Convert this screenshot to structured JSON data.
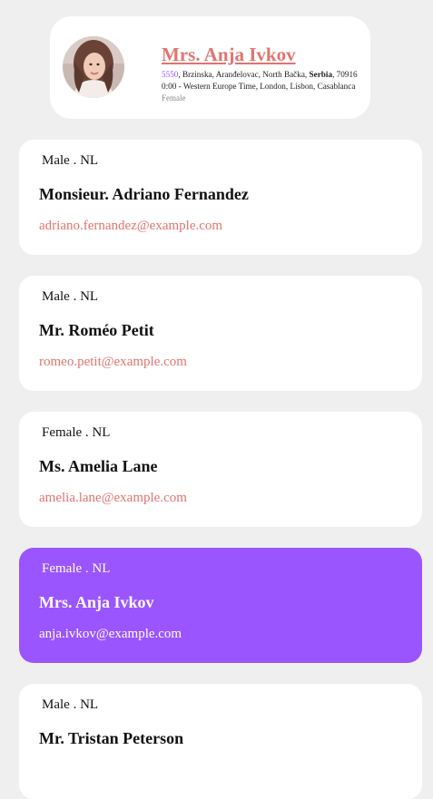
{
  "profile": {
    "name": "Mrs. Anja Ivkov",
    "street_number": "5550",
    "address_rest": ", Brzinska, Aranđelovac, North Bačka, ",
    "country": "Serbia",
    "postcode": ", 70916",
    "timezone": "0:00 - Western Europe Time, London, Lisbon, Casablanca",
    "gender": "Female"
  },
  "users": [
    {
      "meta": "Male . NL",
      "name": "Monsieur. Adriano Fernandez",
      "email": "adriano.fernandez@example.com"
    },
    {
      "meta": "Male . NL",
      "name": "Mr. Roméo Petit",
      "email": "romeo.petit@example.com"
    },
    {
      "meta": "Female . NL",
      "name": "Ms. Amelia Lane",
      "email": "amelia.lane@example.com"
    },
    {
      "meta": "Female . NL",
      "name": "Mrs. Anja Ivkov",
      "email": "anja.ivkov@example.com"
    },
    {
      "meta": "Male . NL",
      "name": "Mr. Tristan Peterson",
      "email": ""
    }
  ],
  "colors": {
    "background": "#efefef",
    "card": "#ffffff",
    "accent_link": "#e07470",
    "selected": "#9a55ff"
  }
}
